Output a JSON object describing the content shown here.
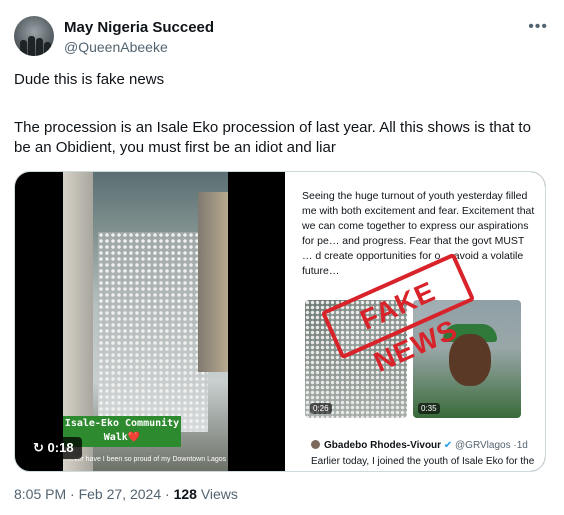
{
  "tweet": {
    "author_name": "May Nigeria Succeed",
    "author_handle": "@QueenAbeeke",
    "more_icon": "more-horizontal-icon",
    "text_line1": "Dude this is fake news",
    "text_line2": "The procession is an Isale Eko procession of last year. All this shows is that to be an Obidient, you must first be an idiot and liar",
    "time": "8:05 PM",
    "date": "Feb 27, 2024",
    "views_count": "128",
    "views_label": "Views",
    "separator": "·"
  },
  "media": {
    "video": {
      "duration": "0:18",
      "replay_icon": "replay-icon",
      "banner_text": "Isale-Eko Community Walk❤️",
      "caption": "…ver have I been so proud of my Downtown Lagos"
    },
    "screenshot": {
      "post_text": "Seeing the huge turnout of youth yesterday filled me with both excitement and fear. Excitement that we can come together to express our aspirations for pe… and progress. Fear that the govt MUST … d create opportunities for o… avoid a volatile future…",
      "stamp_text": "FAKE NEWS",
      "thumb1_time": "0:26",
      "thumb2_time": "0:35",
      "quote_author": "Gbadebo Rhodes-Vivour",
      "quote_handle": "@GRVlagos",
      "quote_age": "1d",
      "quote_text": "Earlier today, I joined the youth of Isale Eko for the"
    }
  },
  "colors": {
    "text": "#0f1419",
    "muted": "#536471",
    "border": "#cfd9de",
    "verified": "#1d9bf0",
    "stamp": "#d8232a",
    "banner": "#2e8a2e"
  }
}
